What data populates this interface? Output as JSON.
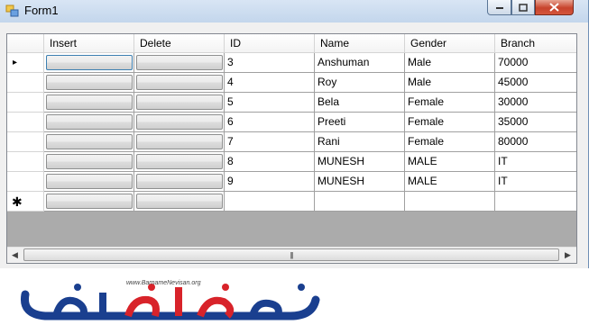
{
  "window": {
    "title": "Form1"
  },
  "grid": {
    "columns": [
      "Insert",
      "Delete",
      "ID",
      "Name",
      "Gender",
      "Branch"
    ],
    "rows": [
      {
        "id": "3",
        "name": "Anshuman",
        "gender": "Male",
        "branch": "70000"
      },
      {
        "id": "4",
        "name": "Roy",
        "gender": "Male",
        "branch": "45000"
      },
      {
        "id": "5",
        "name": "Bela",
        "gender": "Female",
        "branch": "30000"
      },
      {
        "id": "6",
        "name": "Preeti",
        "gender": "Female",
        "branch": "35000"
      },
      {
        "id": "7",
        "name": "Rani",
        "gender": "Female",
        "branch": "80000"
      },
      {
        "id": "8",
        "name": "MUNESH",
        "gender": "MALE",
        "branch": "IT"
      },
      {
        "id": "9",
        "name": "MUNESH",
        "gender": "MALE",
        "branch": "IT"
      }
    ],
    "current_row_marker": "▸",
    "new_row_marker": "✱",
    "scroll_grip": "|||"
  },
  "logo": {
    "site": "www.BarnameNevisan.org",
    "colors": {
      "blue": "#1a3f8f",
      "red": "#d8232a"
    }
  }
}
